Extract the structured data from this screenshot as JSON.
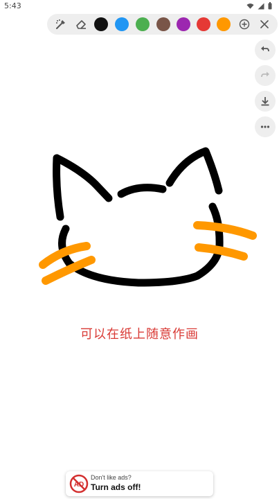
{
  "status_bar": {
    "time": "5:43"
  },
  "toolbar": {
    "colors": [
      "#111111",
      "#2196f3",
      "#4caf50",
      "#795548",
      "#9c27b0",
      "#e53935",
      "#ff9800"
    ]
  },
  "canvas": {
    "hint_text": "可以在纸上随意作画",
    "stroke_colors": {
      "outline": "#000000",
      "whiskers": "#ff9800"
    }
  },
  "ad": {
    "line1": "Don't like ads?",
    "line2": "Turn ads off!",
    "icon_text": "AD"
  }
}
